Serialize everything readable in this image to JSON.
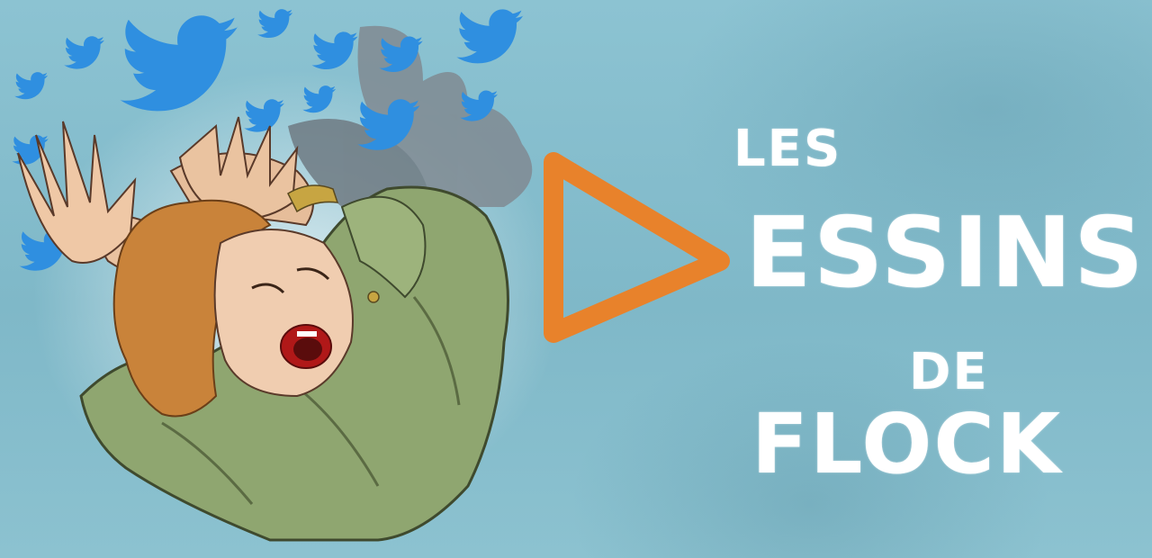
{
  "banner": {
    "title_line_1": "LES",
    "title_line_2": "ESSINS",
    "title_line_3": "DE",
    "title_line_4": "FLOCK"
  },
  "colors": {
    "background": "#84bccb",
    "title_text": "#ffffff",
    "triangle_accent": "#e8822b",
    "bird_blue": "#2f8fe0"
  },
  "icons": {
    "logo_mark": "play-triangle-icon",
    "birds": "twitter-bird-icon"
  }
}
